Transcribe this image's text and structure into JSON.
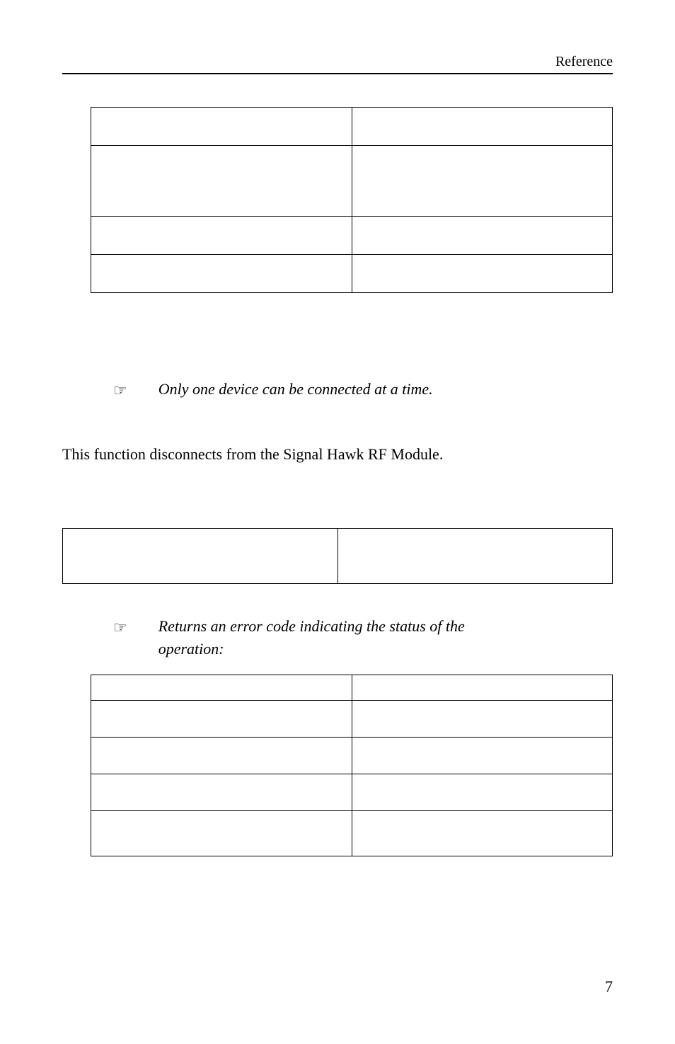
{
  "header": {
    "running": "Reference"
  },
  "notes": {
    "n1": "Only one device can be connected at a time.",
    "n2_pre": "Returns an error code indicating the status of the",
    "n2_post": "operation:"
  },
  "body": {
    "p1": "This function disconnects from the Signal Hawk RF Module."
  },
  "page_number": "7"
}
